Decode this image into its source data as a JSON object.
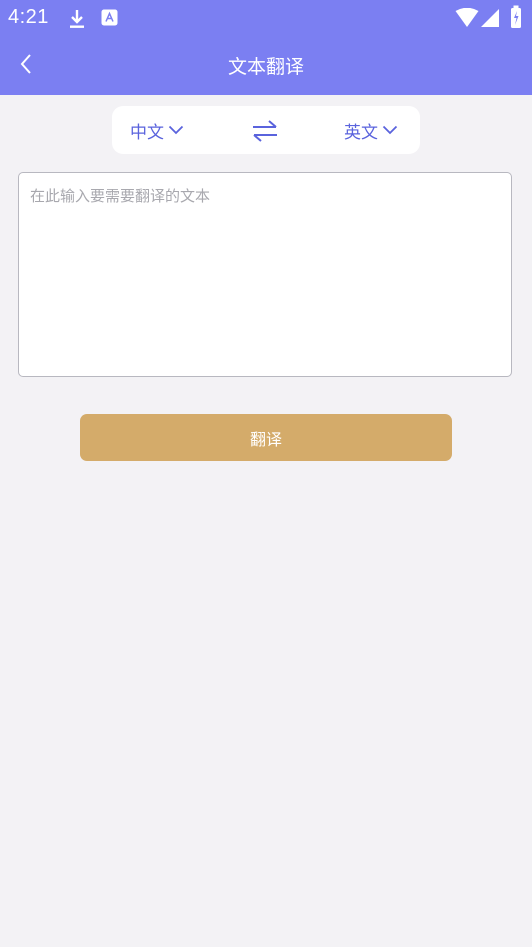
{
  "status_bar": {
    "time": "4:21",
    "icons": [
      "download-icon",
      "notification-a-icon",
      "wifi-icon",
      "cell-signal-icon",
      "battery-icon"
    ]
  },
  "nav": {
    "title": "文本翻译",
    "back_icon": "chevron-left-icon"
  },
  "language_selector": {
    "source_language": "中文",
    "target_language": "英文",
    "swap_icon": "swap-arrows-icon"
  },
  "input": {
    "placeholder": "在此输入要需要翻译的文本",
    "value": ""
  },
  "translate_button": {
    "label": "翻译"
  },
  "colors": {
    "header": "#7b7ff2",
    "accent": "#5a63dd",
    "button": "#d4ab6a",
    "background": "#f3f2f5"
  }
}
